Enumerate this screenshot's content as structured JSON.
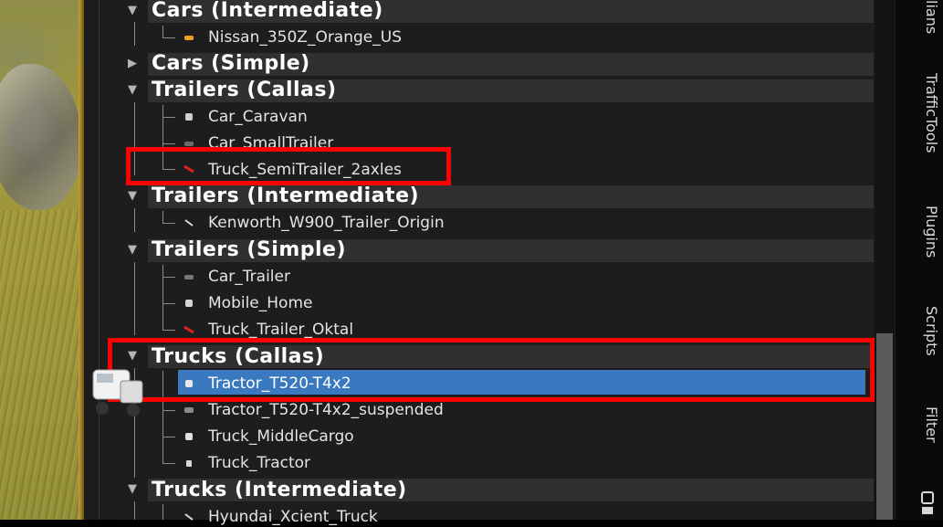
{
  "sidebar": {
    "tabs": [
      "lians",
      "TrafficTools",
      "Plugins",
      "Scripts",
      "Filter"
    ]
  },
  "tree": {
    "groups": [
      {
        "label": "Cars (Intermediate)",
        "items": [
          "Nissan_350Z_Orange_US"
        ]
      },
      {
        "label": "Cars (Simple)",
        "items": []
      },
      {
        "label": "Trailers (Callas)",
        "items": [
          "Car_Caravan",
          "Car_SmallTrailer",
          "Truck_SemiTrailer_2axles"
        ]
      },
      {
        "label": "Trailers (Intermediate)",
        "items": [
          "Kenworth_W900_Trailer_Origin"
        ]
      },
      {
        "label": "Trailers (Simple)",
        "items": [
          "Car_Trailer",
          "Mobile_Home",
          "Truck_Trailer_Oktal"
        ]
      },
      {
        "label": "Trucks (Callas)",
        "items": [
          "Tractor_T520-T4x2",
          "Tractor_T520-T4x2_suspended",
          "Truck_MiddleCargo",
          "Truck_Tractor"
        ]
      },
      {
        "label": "Trucks (Intermediate)",
        "items": [
          "Hyundai_Xcient_Truck"
        ]
      }
    ],
    "selected_item": "Tractor_T520-T4x2"
  },
  "colors": {
    "panel_bg": "#1d1d1d",
    "group_bar": "#303030",
    "selection": "#3a79c0",
    "highlight": "#ff0000"
  }
}
